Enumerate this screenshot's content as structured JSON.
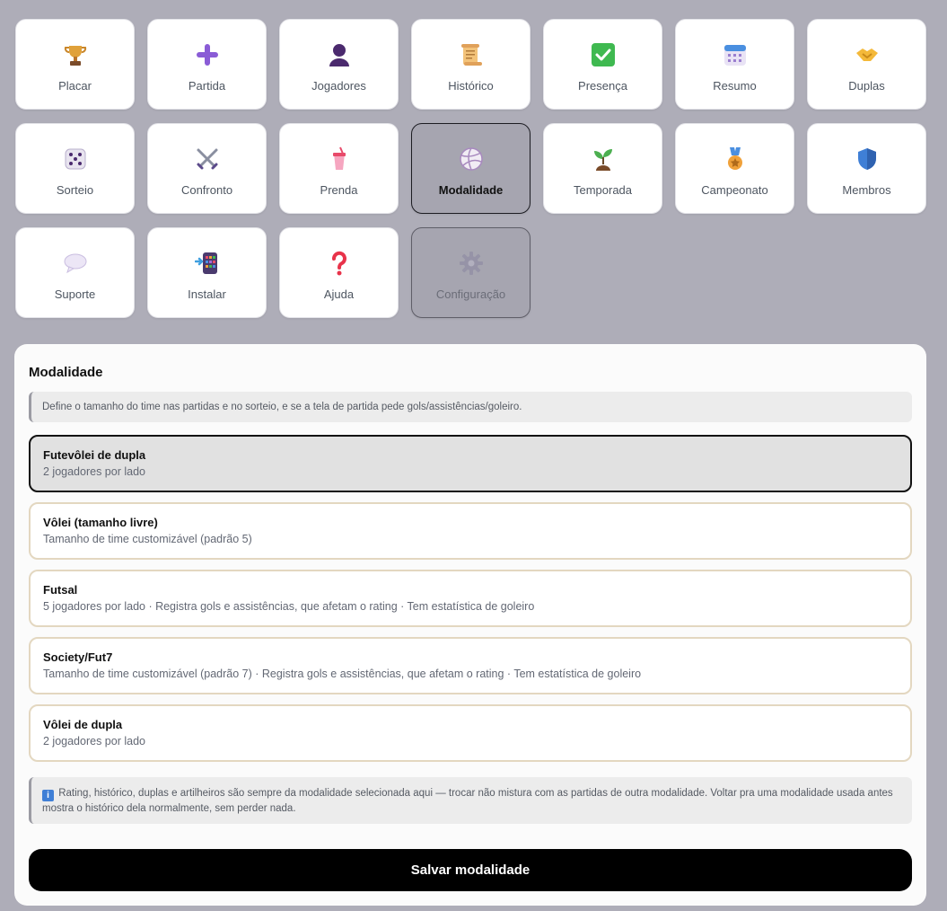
{
  "nav": {
    "tiles": [
      {
        "label": "Placar",
        "icon": "trophy-icon"
      },
      {
        "label": "Partida",
        "icon": "plus-icon"
      },
      {
        "label": "Jogadores",
        "icon": "person-icon"
      },
      {
        "label": "Histórico",
        "icon": "scroll-icon"
      },
      {
        "label": "Presença",
        "icon": "check-box-icon"
      },
      {
        "label": "Resumo",
        "icon": "calendar-icon"
      },
      {
        "label": "Duplas",
        "icon": "handshake-icon"
      },
      {
        "label": "Sorteio",
        "icon": "dice-icon"
      },
      {
        "label": "Confronto",
        "icon": "crossed-swords-icon"
      },
      {
        "label": "Prenda",
        "icon": "cup-straw-icon"
      },
      {
        "label": "Modalidade",
        "icon": "volleyball-icon",
        "active": true
      },
      {
        "label": "Temporada",
        "icon": "seedling-icon"
      },
      {
        "label": "Campeonato",
        "icon": "medal-icon"
      },
      {
        "label": "Membros",
        "icon": "shield-icon"
      },
      {
        "label": "Suporte",
        "icon": "speech-bubble-icon"
      },
      {
        "label": "Instalar",
        "icon": "install-app-icon"
      },
      {
        "label": "Ajuda",
        "icon": "question-icon"
      },
      {
        "label": "Configuração",
        "icon": "gear-icon",
        "disabled": true
      }
    ]
  },
  "panel": {
    "title": "Modalidade",
    "description": "Define o tamanho do time nas partidas e no sorteio, e se a tela de partida pede gols/assistências/goleiro.",
    "options": [
      {
        "title": "Futevôlei de dupla",
        "desc": "2 jogadores por lado",
        "selected": true
      },
      {
        "title": "Vôlei (tamanho livre)",
        "desc": "Tamanho de time customizável (padrão 5)"
      },
      {
        "title": "Futsal",
        "desc": "5 jogadores por lado · Registra gols e assistências, que afetam o rating · Tem estatística de goleiro"
      },
      {
        "title": "Society/Fut7",
        "desc": "Tamanho de time customizável (padrão 7) · Registra gols e assistências, que afetam o rating · Tem estatística de goleiro"
      },
      {
        "title": "Vôlei de dupla",
        "desc": "2 jogadores por lado"
      }
    ],
    "info_icon": "i",
    "info_note": "Rating, histórico, duplas e artilheiros são sempre da modalidade selecionada aqui — trocar não mistura com as partidas de outra modalidade. Voltar pra uma modalidade usada antes mostra o histórico dela normalmente, sem perder nada.",
    "save_label": "Salvar modalidade"
  },
  "colors": {
    "page_bg": "#aeadb8",
    "tile_bg": "#ffffff",
    "active_tile_bg": "#a6a5b0",
    "option_border": "#e3d7c0",
    "selected_border": "#111111",
    "save_bg": "#000000"
  }
}
